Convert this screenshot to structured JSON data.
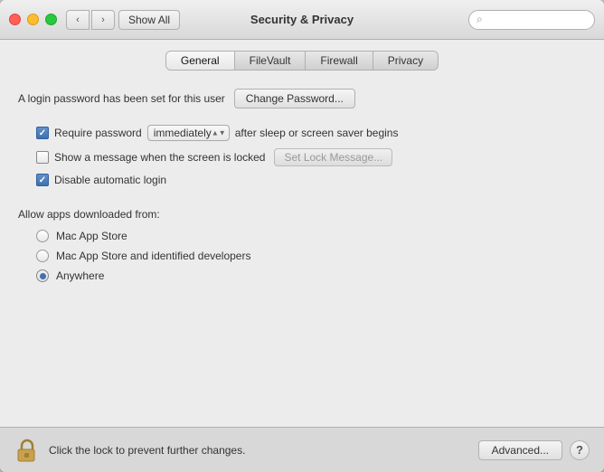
{
  "window": {
    "title": "Security & Privacy"
  },
  "titlebar": {
    "show_all_label": "Show All",
    "search_placeholder": ""
  },
  "tabs": {
    "items": [
      {
        "id": "general",
        "label": "General",
        "active": true
      },
      {
        "id": "filevault",
        "label": "FileVault",
        "active": false
      },
      {
        "id": "firewall",
        "label": "Firewall",
        "active": false
      },
      {
        "id": "privacy",
        "label": "Privacy",
        "active": false
      }
    ]
  },
  "general": {
    "login_text": "A login password has been set for this user",
    "change_password_label": "Change Password...",
    "require_password_label": "Require password",
    "immediately_value": "immediately",
    "after_sleep_text": "after sleep or screen saver begins",
    "show_message_label": "Show a message when the screen is locked",
    "set_lock_label": "Set Lock Message...",
    "disable_login_label": "Disable automatic login",
    "allow_apps_label": "Allow apps downloaded from:",
    "radio_options": [
      {
        "id": "mac-app-store",
        "label": "Mac App Store",
        "selected": false
      },
      {
        "id": "mac-app-store-identified",
        "label": "Mac App Store and identified developers",
        "selected": false
      },
      {
        "id": "anywhere",
        "label": "Anywhere",
        "selected": true
      }
    ]
  },
  "bottombar": {
    "lock_text": "Click the lock to prevent further changes.",
    "advanced_label": "Advanced...",
    "help_label": "?"
  },
  "icons": {
    "back": "‹",
    "forward": "›",
    "search": "🔍",
    "lock_open": "🔓"
  }
}
